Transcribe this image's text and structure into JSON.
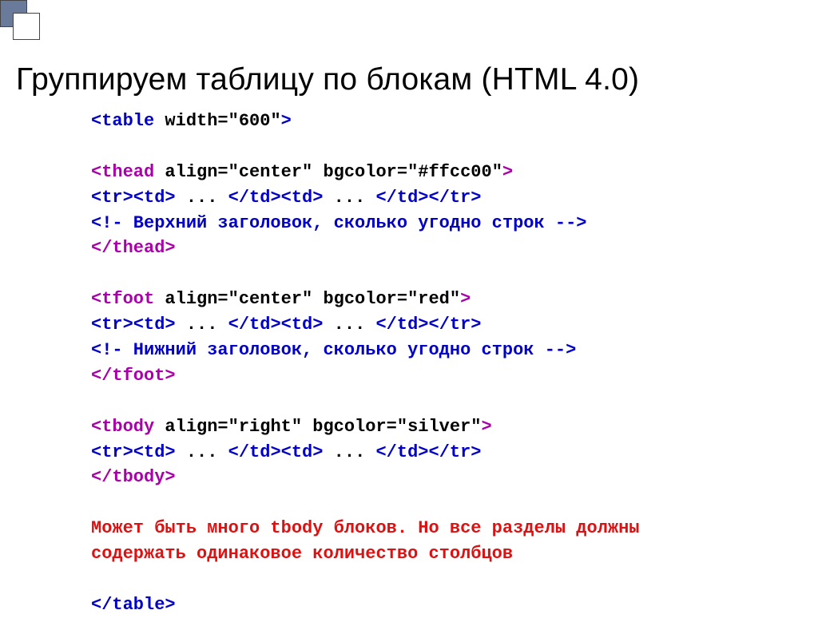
{
  "title": "Группируем таблицу по блокам (HTML 4.0)",
  "code": {
    "l1a": "<table",
    "l1b": " width=\"600\"",
    "l1c": ">",
    "blank": "",
    "l2a": "<thead",
    "l2b": " align=\"center\" bgcolor=\"#ffcc00\"",
    "l2c": ">",
    "l3a": "<tr><td>",
    "l3b": " ... ",
    "l3c": "</td><td>",
    "l3d": " ... ",
    "l3e": "</td></tr>",
    "l4": "<!- Верхний заголовок, сколько угодно строк -->",
    "l5": "</thead>",
    "l6a": "<tfoot",
    "l6b": " align=\"center\" bgcolor=\"red\"",
    "l6c": ">",
    "l7": "<!- Нижний заголовок, сколько угодно строк -->",
    "l8": "</tfoot>",
    "l9a": "<tbody",
    "l9b": " align=\"right\" bgcolor=\"silver\"",
    "l9c": ">",
    "l10": "</tbody>",
    "note1": "Может быть много tbody блоков. Но все разделы должны",
    "note2": "содержать одинаковое количество столбцов",
    "close": "</table>"
  }
}
